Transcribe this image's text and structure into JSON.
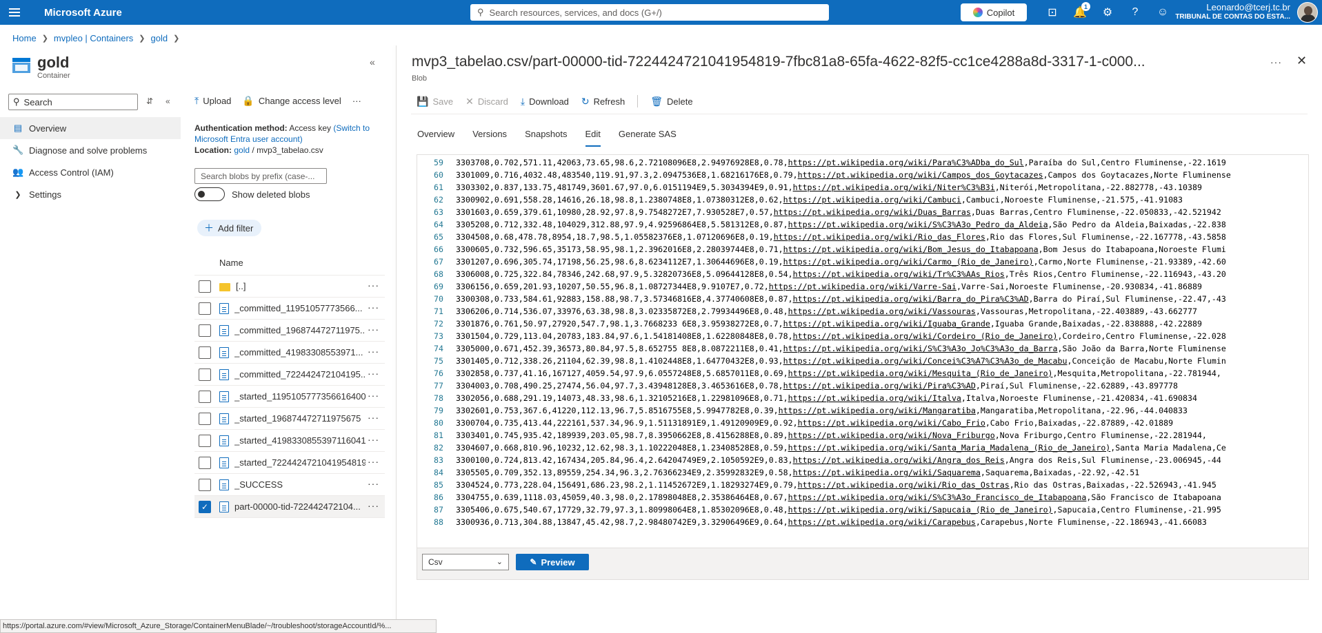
{
  "topbar": {
    "brand": "Microsoft Azure",
    "search_placeholder": "Search resources, services, and docs (G+/)",
    "copilot_label": "Copilot",
    "notification_count": "1",
    "account_email": "Leonardo@tcerj.tc.br",
    "account_org": "TRIBUNAL DE CONTAS DO ESTA..."
  },
  "breadcrumb": [
    "Home",
    "mvpleo | Containers",
    "gold"
  ],
  "resource": {
    "title": "gold",
    "subtitle": "Container"
  },
  "nav": {
    "search_placeholder": "Search",
    "items": [
      "Overview",
      "Diagnose and solve problems",
      "Access Control (IAM)",
      "Settings"
    ]
  },
  "middle": {
    "toolbar": {
      "upload": "Upload",
      "change_access": "Change access level"
    },
    "auth_label": "Authentication method:",
    "auth_value": "Access key",
    "auth_link": "(Switch to Microsoft Entra user account)",
    "location_label": "Location:",
    "location_link": "gold",
    "location_sep": "/",
    "location_file": "mvp3_tabelao.csv",
    "blob_search_placeholder": "Search blobs by prefix (case-...",
    "show_deleted": "Show deleted blobs",
    "add_filter": "Add filter",
    "column_name": "Name",
    "blobs": [
      {
        "name": "[..]",
        "type": "folder",
        "checked": false
      },
      {
        "name": "_committed_11951057773566...",
        "type": "file",
        "checked": false
      },
      {
        "name": "_committed_196874472711975...",
        "type": "file",
        "checked": false
      },
      {
        "name": "_committed_41983308553971...",
        "type": "file",
        "checked": false
      },
      {
        "name": "_committed_722442472104195...",
        "type": "file",
        "checked": false
      },
      {
        "name": "_started_1195105777356616400",
        "type": "file",
        "checked": false
      },
      {
        "name": "_started_196874472711975675",
        "type": "file",
        "checked": false
      },
      {
        "name": "_started_4198330855397116041",
        "type": "file",
        "checked": false
      },
      {
        "name": "_started_7224424721041954819",
        "type": "file",
        "checked": false
      },
      {
        "name": "_SUCCESS",
        "type": "file",
        "checked": false
      },
      {
        "name": "part-00000-tid-722442472104...",
        "type": "file",
        "checked": true
      }
    ]
  },
  "blade": {
    "title": "mvp3_tabelao.csv/part-00000-tid-7224424721041954819-7fbc81a8-65fa-4622-82f5-cc1ce4288a8d-3317-1-c000...",
    "subtitle": "Blob",
    "toolbar": {
      "save": "Save",
      "discard": "Discard",
      "download": "Download",
      "refresh": "Refresh",
      "delete": "Delete"
    },
    "tabs": [
      "Overview",
      "Versions",
      "Snapshots",
      "Edit",
      "Generate SAS"
    ],
    "active_tab": "Edit",
    "format": "Csv",
    "preview": "Preview"
  },
  "editor_lines": [
    {
      "n": "59",
      "pre": "3303708,0.702,571.11,42063,73.65,98.6,2.72108096E8,2.94976928E8,0.78,",
      "url": "https://pt.wikipedia.org/wiki/Para%C3%ADba_do_Sul",
      "post": ",Paraíba do Sul,Centro Fluminense,-22.1619"
    },
    {
      "n": "60",
      "pre": "3301009,0.716,4032.48,483540,119.91,97.3,2.0947536E8,1.68216176E8,0.79,",
      "url": "https://pt.wikipedia.org/wiki/Campos_dos_Goytacazes",
      "post": ",Campos dos Goytacazes,Norte Fluminense"
    },
    {
      "n": "61",
      "pre": "3303302,0.837,133.75,481749,3601.67,97.0,6.0151194E9,5.3034394E9,0.91,",
      "url": "https://pt.wikipedia.org/wiki/Niter%C3%B3i",
      "post": ",Niterói,Metropolitana,-22.882778,-43.10389"
    },
    {
      "n": "62",
      "pre": "3300902,0.691,558.28,14616,26.18,98.8,1.2380748E8,1.07380312E8,0.62,",
      "url": "https://pt.wikipedia.org/wiki/Cambuci",
      "post": ",Cambuci,Noroeste Fluminense,-21.575,-41.91083"
    },
    {
      "n": "63",
      "pre": "3301603,0.659,379.61,10980,28.92,97.8,9.7548272E7,7.930528E7,0.57,",
      "url": "https://pt.wikipedia.org/wiki/Duas_Barras",
      "post": ",Duas Barras,Centro Fluminense,-22.050833,-42.521942"
    },
    {
      "n": "64",
      "pre": "3305208,0.712,332.48,104029,312.88,97.9,4.92596864E8,5.581312E8,0.87,",
      "url": "https://pt.wikipedia.org/wiki/S%C3%A3o_Pedro_da_Aldeia",
      "post": ",São Pedro da Aldeia,Baixadas,-22.838"
    },
    {
      "n": "65",
      "pre": "3304508,0.68,478.78,8954,18.7,98.5,1.05582376E8,1.07120696E8,0.19,",
      "url": "https://pt.wikipedia.org/wiki/Rio_das_Flores",
      "post": ",Rio das Flores,Sul Fluminense,-22.167778,-43.5858"
    },
    {
      "n": "66",
      "pre": "3300605,0.732,596.65,35173,58.95,98.1,2.3962016E8,2.28039744E8,0.71,",
      "url": "https://pt.wikipedia.org/wiki/Bom_Jesus_do_Itabapoana",
      "post": ",Bom Jesus do Itabapoana,Noroeste Flumi"
    },
    {
      "n": "67",
      "pre": "3301207,0.696,305.74,17198,56.25,98.6,8.6234112E7,1.30644696E8,0.19,",
      "url": "https://pt.wikipedia.org/wiki/Carmo_(Rio_de_Janeiro)",
      "post": ",Carmo,Norte Fluminense,-21.93389,-42.60"
    },
    {
      "n": "68",
      "pre": "3306008,0.725,322.84,78346,242.68,97.9,5.32820736E8,5.09644128E8,0.54,",
      "url": "https://pt.wikipedia.org/wiki/Tr%C3%AAs_Rios",
      "post": ",Três Rios,Centro Fluminense,-22.116943,-43.20"
    },
    {
      "n": "69",
      "pre": "3306156,0.659,201.93,10207,50.55,96.8,1.08727344E8,9.9107E7,0.72,",
      "url": "https://pt.wikipedia.org/wiki/Varre-Sai",
      "post": ",Varre-Sai,Noroeste Fluminense,-20.930834,-41.86889"
    },
    {
      "n": "70",
      "pre": "3300308,0.733,584.61,92883,158.88,98.7,3.57346816E8,4.37740608E8,0.87,",
      "url": "https://pt.wikipedia.org/wiki/Barra_do_Pira%C3%AD",
      "post": ",Barra do Piraí,Sul Fluminense,-22.47,-43"
    },
    {
      "n": "71",
      "pre": "3306206,0.714,536.07,33976,63.38,98.8,3.02335872E8,2.79934496E8,0.48,",
      "url": "https://pt.wikipedia.org/wiki/Vassouras",
      "post": ",Vassouras,Metropolitana,-22.403889,-43.662777"
    },
    {
      "n": "72",
      "pre": "3301876,0.761,50.97,27920,547.7,98.1,3.7668233 6E8,3.95938272E8,0.7,",
      "url": "https://pt.wikipedia.org/wiki/Iguaba_Grande",
      "post": ",Iguaba Grande,Baixadas,-22.838888,-42.22889"
    },
    {
      "n": "73",
      "pre": "3301504,0.729,113.04,20783,183.84,97.6,1.54181408E8,1.62280848E8,0.78,",
      "url": "https://pt.wikipedia.org/wiki/Cordeiro_(Rio_de_Janeiro)",
      "post": ",Cordeiro,Centro Fluminense,-22.028"
    },
    {
      "n": "74",
      "pre": "3305000,0.671,452.39,36573,80.84,97.5,8.652755 8E8,8.0872211E8,0.41,",
      "url": "https://pt.wikipedia.org/wiki/S%C3%A3o_Jo%C3%A3o_da_Barra",
      "post": ",São João da Barra,Norte Fluminense"
    },
    {
      "n": "75",
      "pre": "3301405,0.712,338.26,21104,62.39,98.8,1.4102448E8,1.64770432E8,0.93,",
      "url": "https://pt.wikipedia.org/wiki/Concei%C3%A7%C3%A3o_de_Macabu",
      "post": ",Conceição de Macabu,Norte Flumin"
    },
    {
      "n": "76",
      "pre": "3302858,0.737,41.16,167127,4059.54,97.9,6.0557248E8,5.6857011E8,0.69,",
      "url": "https://pt.wikipedia.org/wiki/Mesquita_(Rio_de_Janeiro)",
      "post": ",Mesquita,Metropolitana,-22.781944,"
    },
    {
      "n": "77",
      "pre": "3304003,0.708,490.25,27474,56.04,97.7,3.43948128E8,3.4653616E8,0.78,",
      "url": "https://pt.wikipedia.org/wiki/Pira%C3%AD",
      "post": ",Piraí,Sul Fluminense,-22.62889,-43.897778"
    },
    {
      "n": "78",
      "pre": "3302056,0.688,291.19,14073,48.33,98.6,1.32105216E8,1.22981096E8,0.71,",
      "url": "https://pt.wikipedia.org/wiki/Italva",
      "post": ",Italva,Noroeste Fluminense,-21.420834,-41.690834"
    },
    {
      "n": "79",
      "pre": "3302601,0.753,367.6,41220,112.13,96.7,5.8516755E8,5.9947782E8,0.39,",
      "url": "https://pt.wikipedia.org/wiki/Mangaratiba",
      "post": ",Mangaratiba,Metropolitana,-22.96,-44.040833"
    },
    {
      "n": "80",
      "pre": "3300704,0.735,413.44,222161,537.34,96.9,1.51131891E9,1.49120909E9,0.92,",
      "url": "https://pt.wikipedia.org/wiki/Cabo_Frio",
      "post": ",Cabo Frio,Baixadas,-22.87889,-42.01889"
    },
    {
      "n": "81",
      "pre": "3303401,0.745,935.42,189939,203.05,98.7,8.3950662E8,8.4156288E8,0.89,",
      "url": "https://pt.wikipedia.org/wiki/Nova_Friburgo",
      "post": ",Nova Friburgo,Centro Fluminense,-22.281944,"
    },
    {
      "n": "82",
      "pre": "3304607,0.668,810.96,10232,12.62,98.3,1.10222048E8,1.23408528E8,0.59,",
      "url": "https://pt.wikipedia.org/wiki/Santa_Maria_Madalena_(Rio_de_Janeiro)",
      "post": ",Santa Maria Madalena,Ce"
    },
    {
      "n": "83",
      "pre": "3300100,0.724,813.42,167434,205.84,96.4,2.64204749E9,2.1050592E9,0.83,",
      "url": "https://pt.wikipedia.org/wiki/Angra_dos_Reis",
      "post": ",Angra dos Reis,Sul Fluminense,-23.006945,-44"
    },
    {
      "n": "84",
      "pre": "3305505,0.709,352.13,89559,254.34,96.3,2.76366234E9,2.35992832E9,0.58,",
      "url": "https://pt.wikipedia.org/wiki/Saquarema",
      "post": ",Saquarema,Baixadas,-22.92,-42.51"
    },
    {
      "n": "85",
      "pre": "3304524,0.773,228.04,156491,686.23,98.2,1.11452672E9,1.18293274E9,0.79,",
      "url": "https://pt.wikipedia.org/wiki/Rio_das_Ostras",
      "post": ",Rio das Ostras,Baixadas,-22.526943,-41.945"
    },
    {
      "n": "86",
      "pre": "3304755,0.639,1118.03,45059,40.3,98.0,2.17898048E8,2.35386464E8,0.67,",
      "url": "https://pt.wikipedia.org/wiki/S%C3%A3o_Francisco_de_Itabapoana",
      "post": ",São Francisco de Itabapoana"
    },
    {
      "n": "87",
      "pre": "3305406,0.675,540.67,17729,32.79,97.3,1.80998064E8,1.85302096E8,0.48,",
      "url": "https://pt.wikipedia.org/wiki/Sapucaia_(Rio_de_Janeiro)",
      "post": ",Sapucaia,Centro Fluminense,-21.995"
    },
    {
      "n": "88",
      "pre": "3300936,0.713,304.88,13847,45.42,98.7,2.98480742E9,3.32906496E9,0.64,",
      "url": "https://pt.wikipedia.org/wiki/Carapebus",
      "post": ",Carapebus,Norte Fluminense,-22.186943,-41.66083"
    }
  ],
  "statusbar": "https://portal.azure.com/#view/Microsoft_Azure_Storage/ContainerMenuBlade/~/troubleshoot/storageAccountId/%..."
}
